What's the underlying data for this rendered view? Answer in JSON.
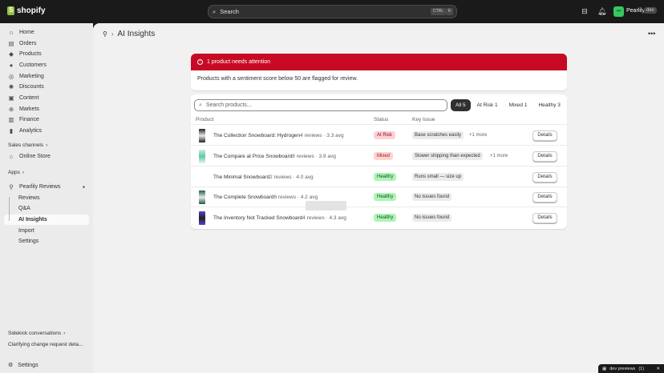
{
  "topbar": {
    "brand": "shopify",
    "search_placeholder": "Search",
    "kbd_ctrl": "CTRL",
    "kbd_k": "K",
    "store_name": "Pearlily",
    "store_badge": "dev",
    "store_initials": "•••"
  },
  "sidebar": {
    "nav": [
      "Home",
      "Orders",
      "Products",
      "Customers",
      "Marketing",
      "Discounts",
      "Content",
      "Markets",
      "Finance",
      "Analytics"
    ],
    "sales_channels_label": "Sales channels",
    "online_store": "Online Store",
    "apps_label": "Apps",
    "app_name": "Pearlily Reviews",
    "app_sub": [
      "Reviews",
      "Q&A",
      "AI Insights",
      "Import",
      "Settings"
    ],
    "sidekick_label": "Sidekick conversations",
    "sidekick_item": "Clarifying change request deta...",
    "settings": "Settings"
  },
  "page": {
    "title": "AI Insights"
  },
  "banner": {
    "title": "1 product needs attention",
    "body": "Products with a sentiment score below 50 are flagged for review."
  },
  "table": {
    "search_placeholder": "Search products...",
    "tabs": [
      "All 5",
      "At Risk 1",
      "Mixed 1",
      "Healthy 3"
    ],
    "headers": [
      "Product",
      "Status",
      "Key Issue"
    ],
    "details_label": "Details",
    "rows": [
      {
        "name": "The Collection Snowboard: Hydrogen",
        "meta": "4 reviews · 3.3 avg",
        "status": "At Risk",
        "issue": "Base scratches easily",
        "more": "+1 more"
      },
      {
        "name": "The Compare at Price Snowboard",
        "meta": "8 reviews · 3.9 avg",
        "status": "Mixed",
        "issue": "Slower shipping than expected",
        "more": "+1 more"
      },
      {
        "name": "The Minimal Snowboard",
        "meta": "2 reviews · 4.0 avg",
        "status": "Healthy",
        "issue": "Runs small — size up",
        "more": ""
      },
      {
        "name": "The Complete Snowboard",
        "meta": "6 reviews · 4.2 avg",
        "status": "Healthy",
        "issue": "No issues found",
        "more": ""
      },
      {
        "name": "The Inventory Not Tracked Snowboard",
        "meta": "4 reviews · 4.3 avg",
        "status": "Healthy",
        "issue": "No issues found",
        "more": ""
      }
    ]
  },
  "dev_previews": {
    "label": "dev previews",
    "count": "(1)"
  },
  "colors": {
    "critical": "#c70a24",
    "at_risk_bg": "#fed1d7",
    "mixed_bg": "#fed3d1",
    "healthy_bg": "#aff5b4"
  }
}
